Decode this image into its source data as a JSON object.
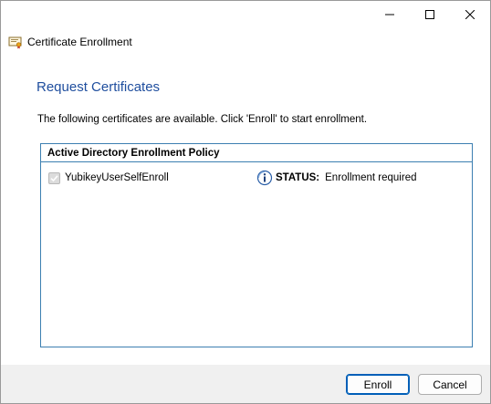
{
  "window": {
    "controls": {
      "minimize_icon": "minimize-icon",
      "maximize_icon": "maximize-icon",
      "close_icon": "close-icon"
    }
  },
  "wizard": {
    "title": "Certificate Enrollment",
    "icon": "certificate-icon"
  },
  "page": {
    "title": "Request Certificates",
    "instructions": "The following certificates are available. Click 'Enroll' to start enrollment."
  },
  "policy": {
    "header": "Active Directory Enrollment Policy",
    "certificates": [
      {
        "name": "YubikeyUserSelfEnroll",
        "checked": true,
        "status_label": "STATUS:",
        "status_value": "Enrollment required",
        "status_icon": "info-icon"
      }
    ]
  },
  "footer": {
    "enroll_accel": "E",
    "enroll_rest": "nroll",
    "cancel_label": "Cancel"
  },
  "colors": {
    "page_title": "#1f4e9e",
    "policy_border": "#3c7fb1",
    "footer_bg": "#f0f0f0",
    "default_button_border": "#005fb8"
  }
}
